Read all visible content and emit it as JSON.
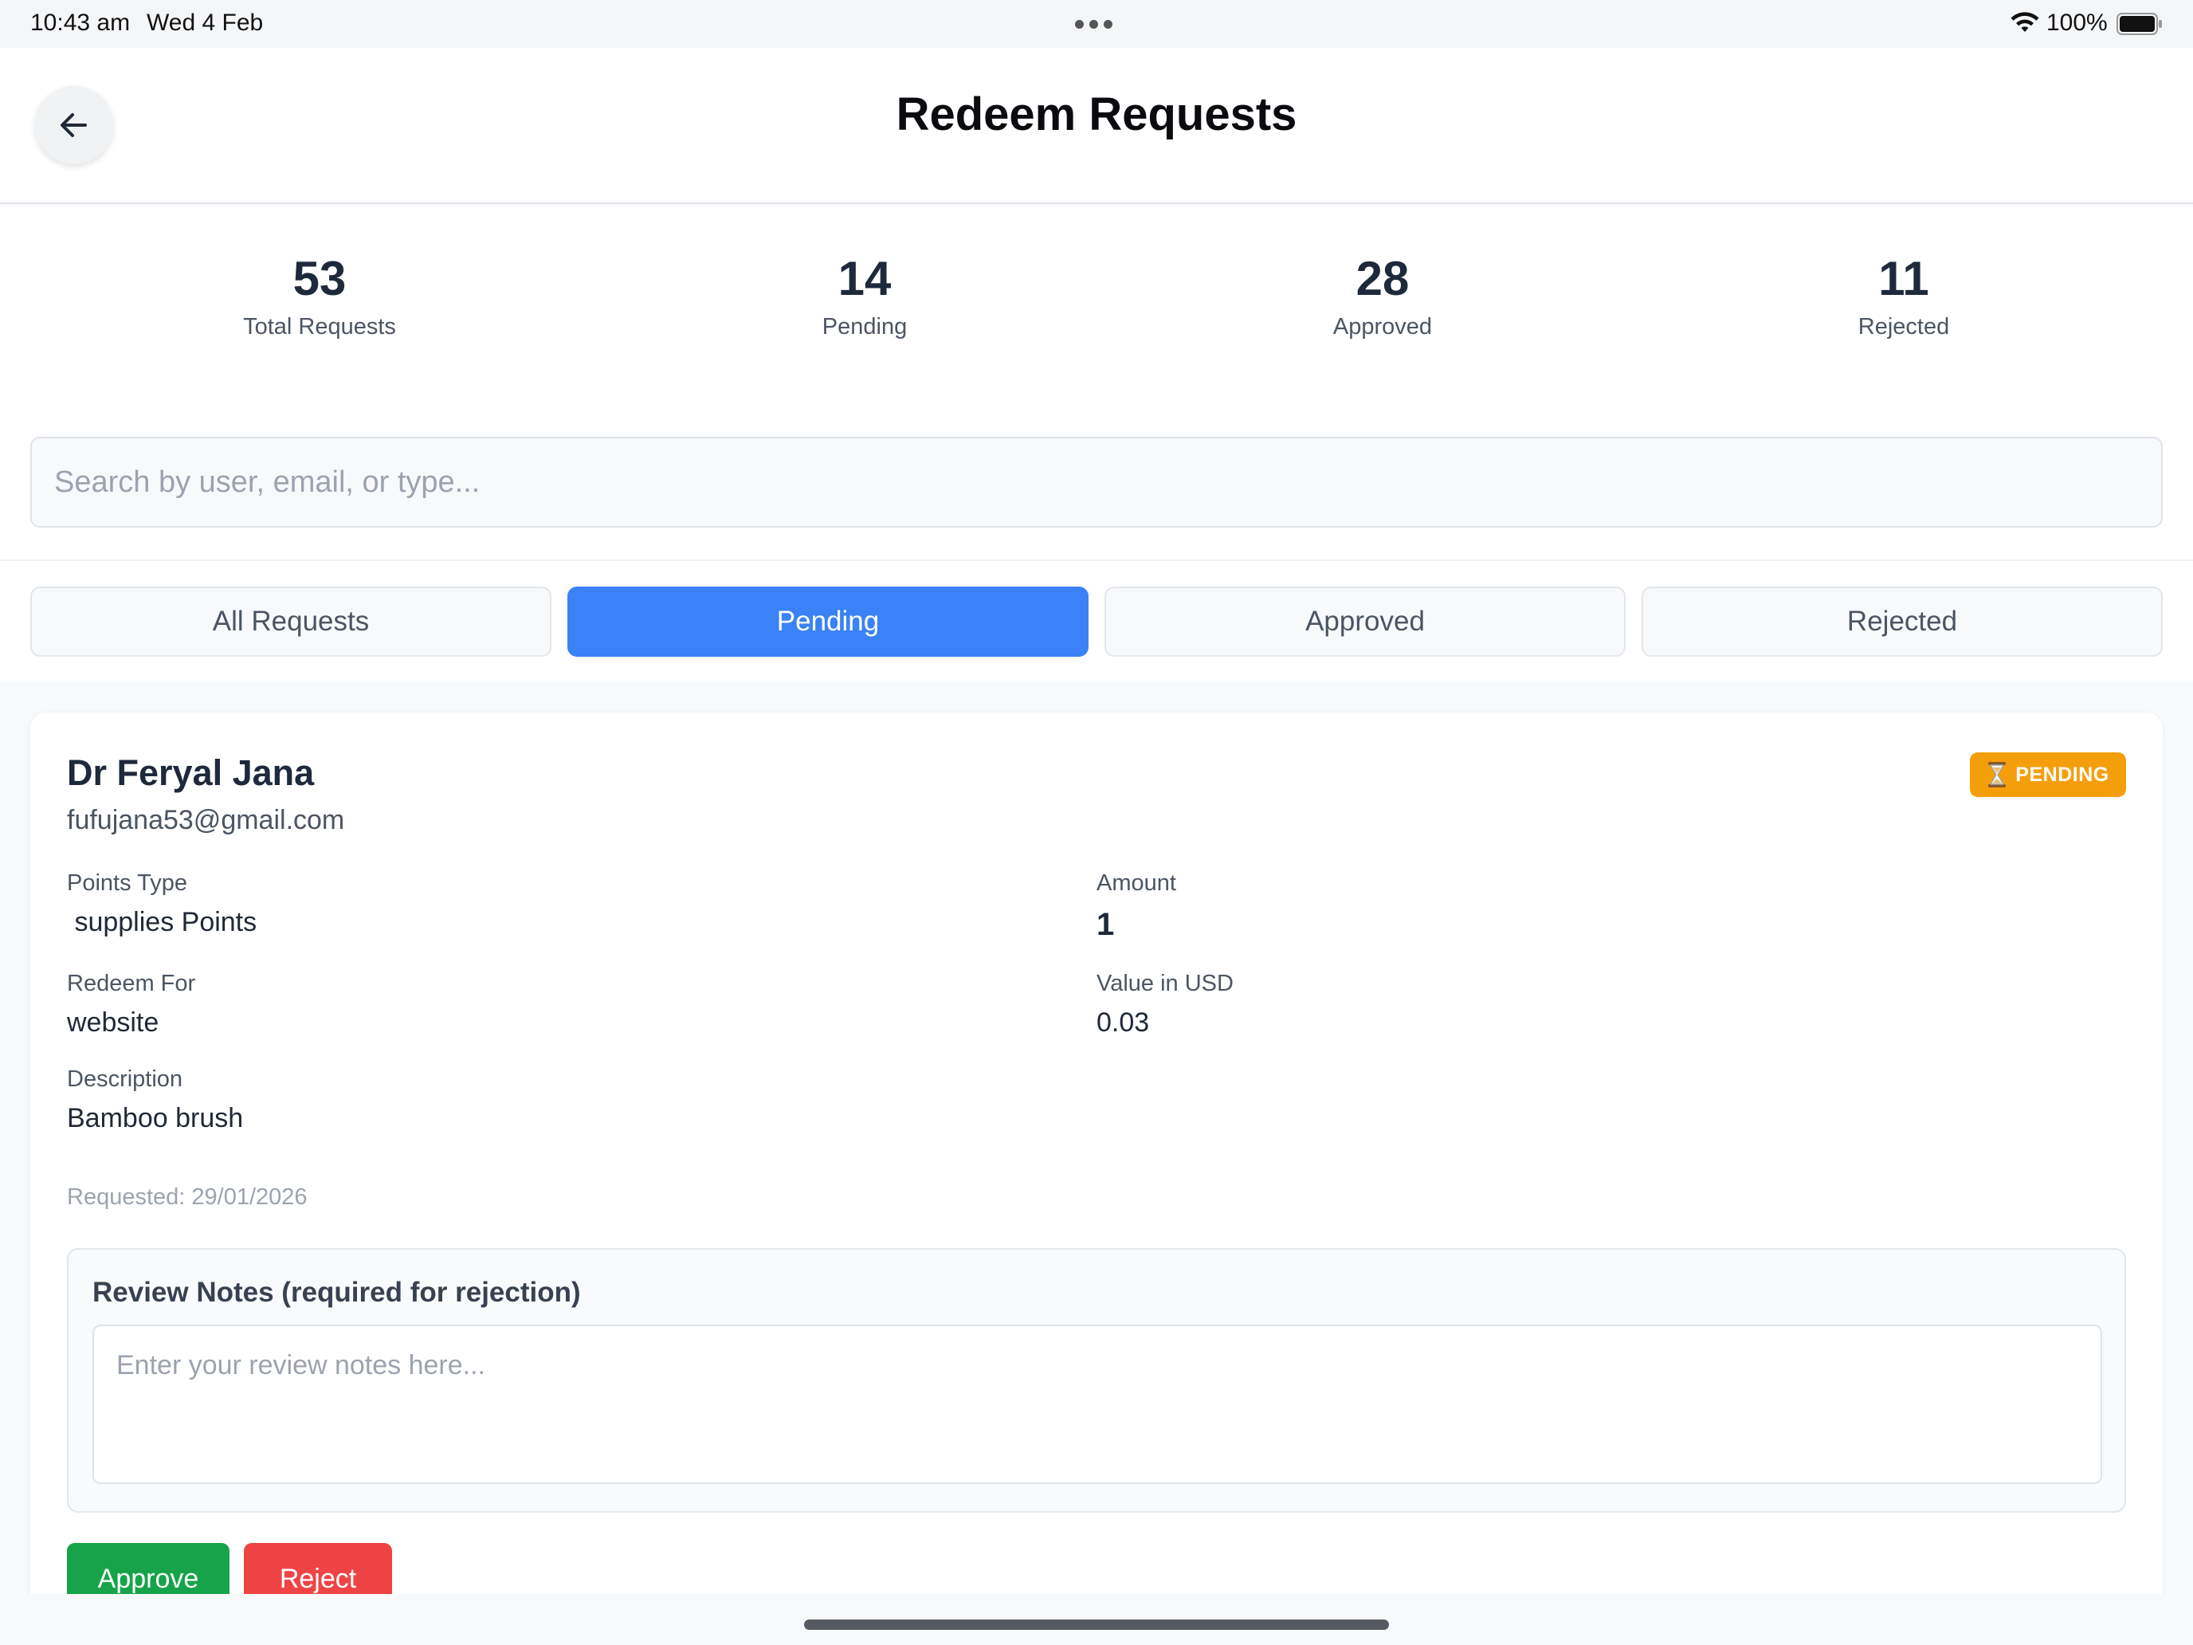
{
  "status_bar": {
    "time": "10:43 am",
    "date": "Wed 4 Feb",
    "battery_pct": "100%"
  },
  "header": {
    "title": "Redeem Requests",
    "back_icon": "arrow-left-icon"
  },
  "stats": [
    {
      "value": "53",
      "label": "Total Requests"
    },
    {
      "value": "14",
      "label": "Pending"
    },
    {
      "value": "28",
      "label": "Approved"
    },
    {
      "value": "11",
      "label": "Rejected"
    }
  ],
  "search": {
    "placeholder": "Search by user, email, or type...",
    "value": ""
  },
  "tabs": [
    {
      "label": "All Requests",
      "active": false
    },
    {
      "label": "Pending",
      "active": true
    },
    {
      "label": "Approved",
      "active": false
    },
    {
      "label": "Rejected",
      "active": false
    }
  ],
  "request": {
    "name": "Dr Feryal Jana",
    "email": "fufujana53@gmail.com",
    "status": "PENDING",
    "status_icon": "hourglass-icon",
    "points_type_label": "Points Type",
    "points_type": " supplies Points",
    "amount_label": "Amount",
    "amount": "1",
    "redeem_for_label": "Redeem For",
    "redeem_for": "website",
    "value_usd_label": "Value in USD",
    "value_usd": "0.03",
    "description_label": "Description",
    "description": "Bamboo brush",
    "requested": "Requested: 29/01/2026",
    "review_notes_label": "Review Notes (required for rejection)",
    "review_notes_placeholder": "Enter your review notes here...",
    "approve_label": "Approve",
    "reject_label": "Reject"
  },
  "colors": {
    "accent": "#3b82f6",
    "pending": "#f59e0b",
    "approve": "#16a34a",
    "reject": "#ef4444"
  }
}
